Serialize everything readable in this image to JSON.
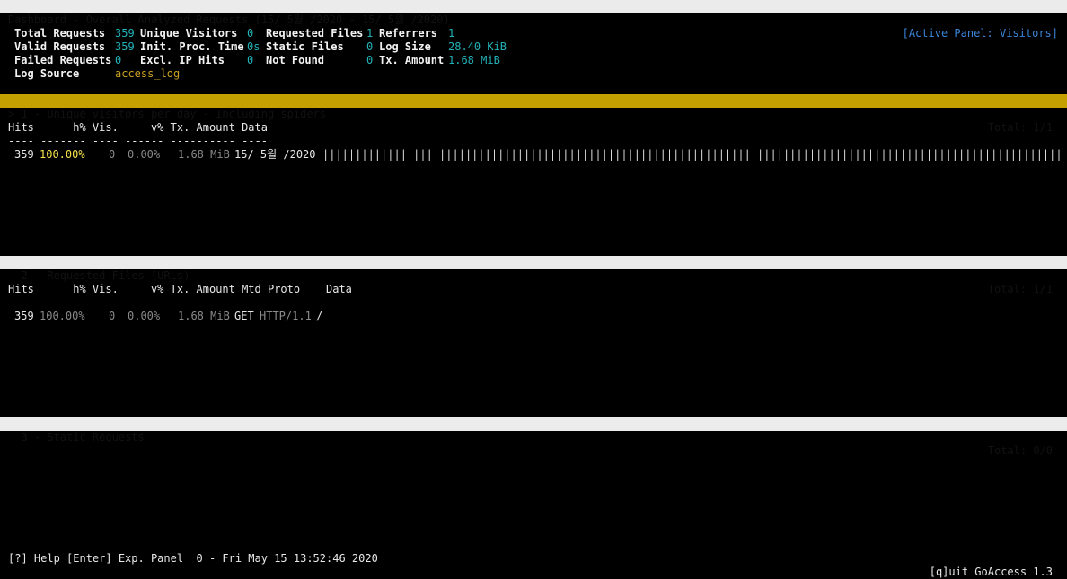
{
  "header": {
    "title": "Dashboard - Overall Analyzed Requests (15/ 5월 /2020 - 15/ 5월 /2020)",
    "active_panel": "[Active Panel: Visitors]"
  },
  "overview": {
    "total_requests_label": "Total Requests",
    "total_requests": "359",
    "valid_requests_label": "Valid Requests",
    "valid_requests": "359",
    "failed_requests_label": "Failed Requests",
    "failed_requests": "0",
    "log_source_label": "Log Source",
    "log_source": "access_log",
    "unique_visitors_label": "Unique Visitors",
    "unique_visitors": "0",
    "init_proc_label": "Init. Proc. Time",
    "init_proc": "0s",
    "excl_ip_label": "Excl. IP Hits",
    "excl_ip": "0",
    "requested_files_label": "Requested Files",
    "requested_files": "1",
    "static_files_label": "Static Files",
    "static_files": "0",
    "not_found_label": "Not Found",
    "not_found": "0",
    "referrers_label": "Referrers",
    "referrers": "1",
    "log_size_label": "Log Size",
    "log_size": "28.40 KiB",
    "tx_amount_label": "Tx. Amount",
    "tx_amount": "1.68 MiB"
  },
  "panels": [
    {
      "title": "> 1 - Unique visitors per day - Including spiders",
      "total": "Total: 1/1",
      "header": "Hits      h% Vis.     v% Tx. Amount Data",
      "separator": "---- ------- ---- ------ ---------- ----",
      "row": {
        "hits": "359",
        "hits_pct": "100.00%",
        "visitors": "0",
        "visitors_pct": "0.00%",
        "tx_amount": "1.68 MiB",
        "data": "15/ 5월 /2020",
        "bar": "||||||||||||||||||||||||||||||||||||||||||||||||||||||||||||||||||||||||||||||||||||||||||||||||||||||||||||||||||||||||||||||||||||||||||||||||||||"
      }
    },
    {
      "title": "  2 - Requested Files (URLs)",
      "total": "Total: 1/1",
      "header": "Hits      h% Vis.     v% Tx. Amount Mtd Proto    Data",
      "separator": "---- ------- ---- ------ ---------- --- -------- ----",
      "row": {
        "hits": "359",
        "hits_pct": "100.00%",
        "visitors": "0",
        "visitors_pct": "0.00%",
        "tx_amount": "1.68 MiB",
        "method": "GET",
        "protocol": "HTTP/1.1",
        "data": "/"
      }
    },
    {
      "title": "  3 - Static Requests",
      "total": "Total: 0/0"
    }
  ],
  "footer": {
    "left": "[?] Help [Enter] Exp. Panel  0 - Fri May 15 13:52:46 2020",
    "right": "[q]uit GoAccess 1.3"
  }
}
